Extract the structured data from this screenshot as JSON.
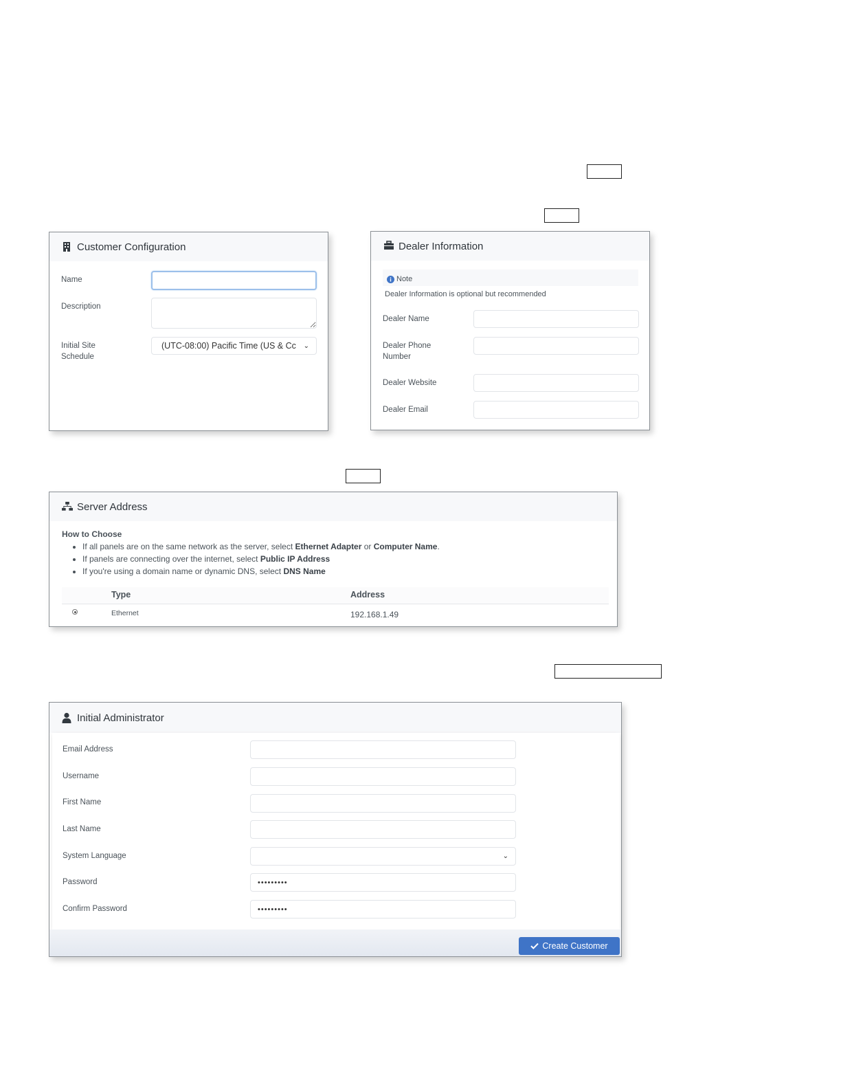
{
  "customer_config": {
    "title": "Customer Configuration",
    "icon": "building-icon",
    "name_label": "Name",
    "name_value": "",
    "description_label": "Description",
    "description_value": "",
    "schedule_label_line1": "Initial Site",
    "schedule_label_line2": "Schedule",
    "schedule_value": "(UTC-08:00) Pacific Time (US & Cc"
  },
  "dealer_info": {
    "title": "Dealer Information",
    "icon": "briefcase-icon",
    "note_title": "Note",
    "note_text": "Dealer Information is optional but recommended",
    "dealer_name_label": "Dealer Name",
    "dealer_phone_label_line1": "Dealer Phone",
    "dealer_phone_label_line2": "Number",
    "dealer_website_label": "Dealer Website",
    "dealer_email_label": "Dealer Email"
  },
  "server_address": {
    "title": "Server Address",
    "icon": "network-icon",
    "how_to_choose": "How to Choose",
    "bullets": [
      {
        "pre": "If all panels are on the same network as the server, select ",
        "b1": "Ethernet Adapter",
        "mid": " or ",
        "b2": "Computer Name",
        "post": "."
      },
      {
        "pre": "If panels are connecting over the internet, select ",
        "b1": "Public IP Address",
        "mid": "",
        "b2": "",
        "post": ""
      },
      {
        "pre": "If you're using a domain name or dynamic DNS, select ",
        "b1": "DNS Name",
        "mid": "",
        "b2": "",
        "post": ""
      }
    ],
    "col_type": "Type",
    "col_address": "Address",
    "rows": [
      {
        "type": "Ethernet",
        "address": "192.168.1.49",
        "selected": true
      }
    ]
  },
  "initial_admin": {
    "title": "Initial Administrator",
    "icon": "user-icon",
    "email_label": "Email Address",
    "username_label": "Username",
    "first_name_label": "First Name",
    "last_name_label": "Last Name",
    "language_label": "System Language",
    "language_value": "",
    "password_label": "Password",
    "password_value": "•••••••••",
    "confirm_label": "Confirm Password",
    "confirm_value": "•••••••••",
    "create_button": "Create Customer"
  },
  "colors": {
    "accent": "#3f74c7",
    "focus_border": "#9cc0ea",
    "note_icon": "#3f74c7"
  }
}
